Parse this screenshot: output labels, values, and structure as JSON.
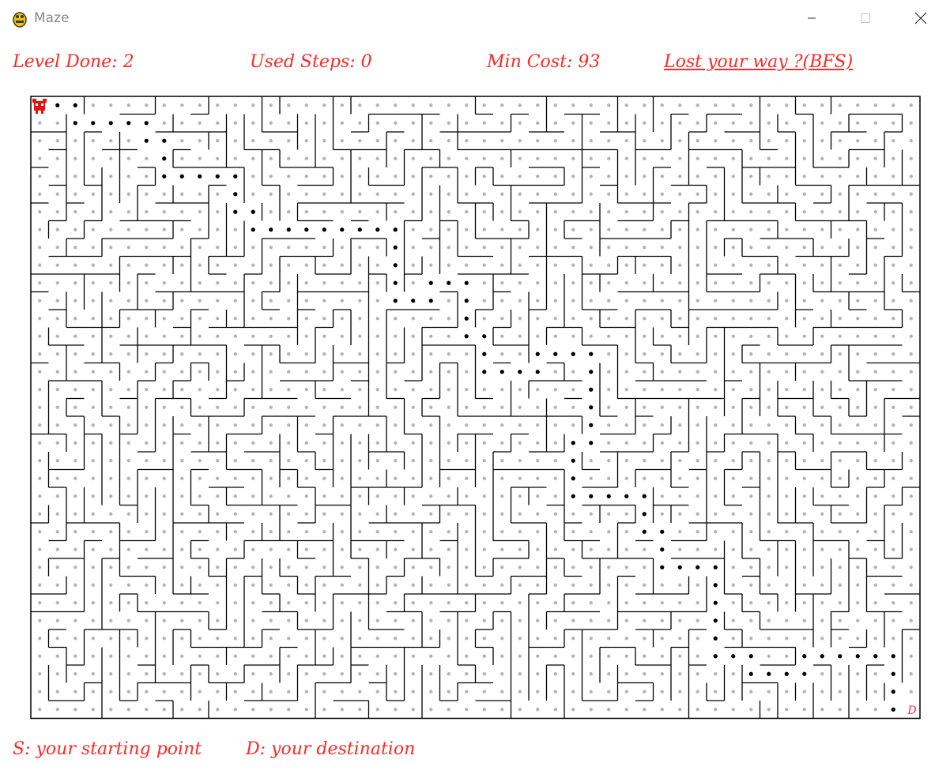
{
  "window": {
    "title": "Maze",
    "icon": "pygame-snake-icon",
    "controls": [
      "minimize-icon",
      "maximize-icon",
      "close-icon"
    ]
  },
  "hud": {
    "level_done": "Level Done: 2",
    "used_steps": "Used Steps: 0",
    "min_cost": "Min Cost: 93",
    "bfs_link": "Lost your way ?(BFS)"
  },
  "maze": {
    "columns": 50,
    "rows": 35,
    "player_icon": "red-robot-icon",
    "destination_label": "D",
    "wall_color": "#000000",
    "cell_dot_color": "#b4b4b4",
    "path_dot_color": "#000000",
    "bfs_path": [
      [
        0,
        0
      ],
      [
        1,
        0
      ],
      [
        2,
        0
      ],
      [
        2,
        1
      ],
      [
        3,
        1
      ],
      [
        4,
        1
      ],
      [
        5,
        1
      ],
      [
        6,
        1
      ],
      [
        6,
        2
      ],
      [
        7,
        2
      ],
      [
        7,
        3
      ],
      [
        7,
        4
      ],
      [
        8,
        4
      ],
      [
        9,
        4
      ],
      [
        10,
        4
      ],
      [
        11,
        4
      ],
      [
        11,
        5
      ],
      [
        11,
        6
      ],
      [
        12,
        6
      ],
      [
        12,
        7
      ],
      [
        13,
        7
      ],
      [
        14,
        7
      ],
      [
        15,
        7
      ],
      [
        16,
        7
      ],
      [
        17,
        7
      ],
      [
        18,
        7
      ],
      [
        19,
        7
      ],
      [
        20,
        7
      ],
      [
        20,
        8
      ],
      [
        20,
        9
      ],
      [
        20,
        10
      ],
      [
        20,
        11
      ],
      [
        21,
        11
      ],
      [
        22,
        11
      ],
      [
        22,
        10
      ],
      [
        23,
        10
      ],
      [
        24,
        10
      ],
      [
        24,
        11
      ],
      [
        24,
        12
      ],
      [
        24,
        13
      ],
      [
        25,
        13
      ],
      [
        25,
        14
      ],
      [
        25,
        15
      ],
      [
        26,
        15
      ],
      [
        27,
        15
      ],
      [
        28,
        15
      ],
      [
        28,
        14
      ],
      [
        29,
        14
      ],
      [
        30,
        14
      ],
      [
        31,
        14
      ],
      [
        31,
        15
      ],
      [
        31,
        16
      ],
      [
        31,
        17
      ],
      [
        31,
        18
      ],
      [
        31,
        19
      ],
      [
        30,
        19
      ],
      [
        30,
        20
      ],
      [
        30,
        21
      ],
      [
        30,
        22
      ],
      [
        31,
        22
      ],
      [
        32,
        22
      ],
      [
        33,
        22
      ],
      [
        34,
        22
      ],
      [
        34,
        23
      ],
      [
        34,
        24
      ],
      [
        35,
        24
      ],
      [
        35,
        25
      ],
      [
        35,
        26
      ],
      [
        36,
        26
      ],
      [
        37,
        26
      ],
      [
        38,
        26
      ],
      [
        38,
        27
      ],
      [
        38,
        28
      ],
      [
        38,
        29
      ],
      [
        38,
        30
      ],
      [
        38,
        31
      ],
      [
        39,
        31
      ],
      [
        40,
        31
      ],
      [
        40,
        32
      ],
      [
        41,
        32
      ],
      [
        42,
        32
      ],
      [
        43,
        32
      ],
      [
        43,
        31
      ],
      [
        44,
        31
      ],
      [
        45,
        31
      ],
      [
        46,
        31
      ],
      [
        47,
        31
      ],
      [
        48,
        31
      ],
      [
        48,
        32
      ],
      [
        48,
        33
      ],
      [
        48,
        34
      ],
      [
        49,
        34
      ]
    ]
  },
  "legend": {
    "start": "S: your starting point",
    "destination": "D: your destination"
  },
  "colors": {
    "hud_text": "#ff2a2a",
    "background": "#ffffff",
    "title_text": "#8a8a8a"
  }
}
